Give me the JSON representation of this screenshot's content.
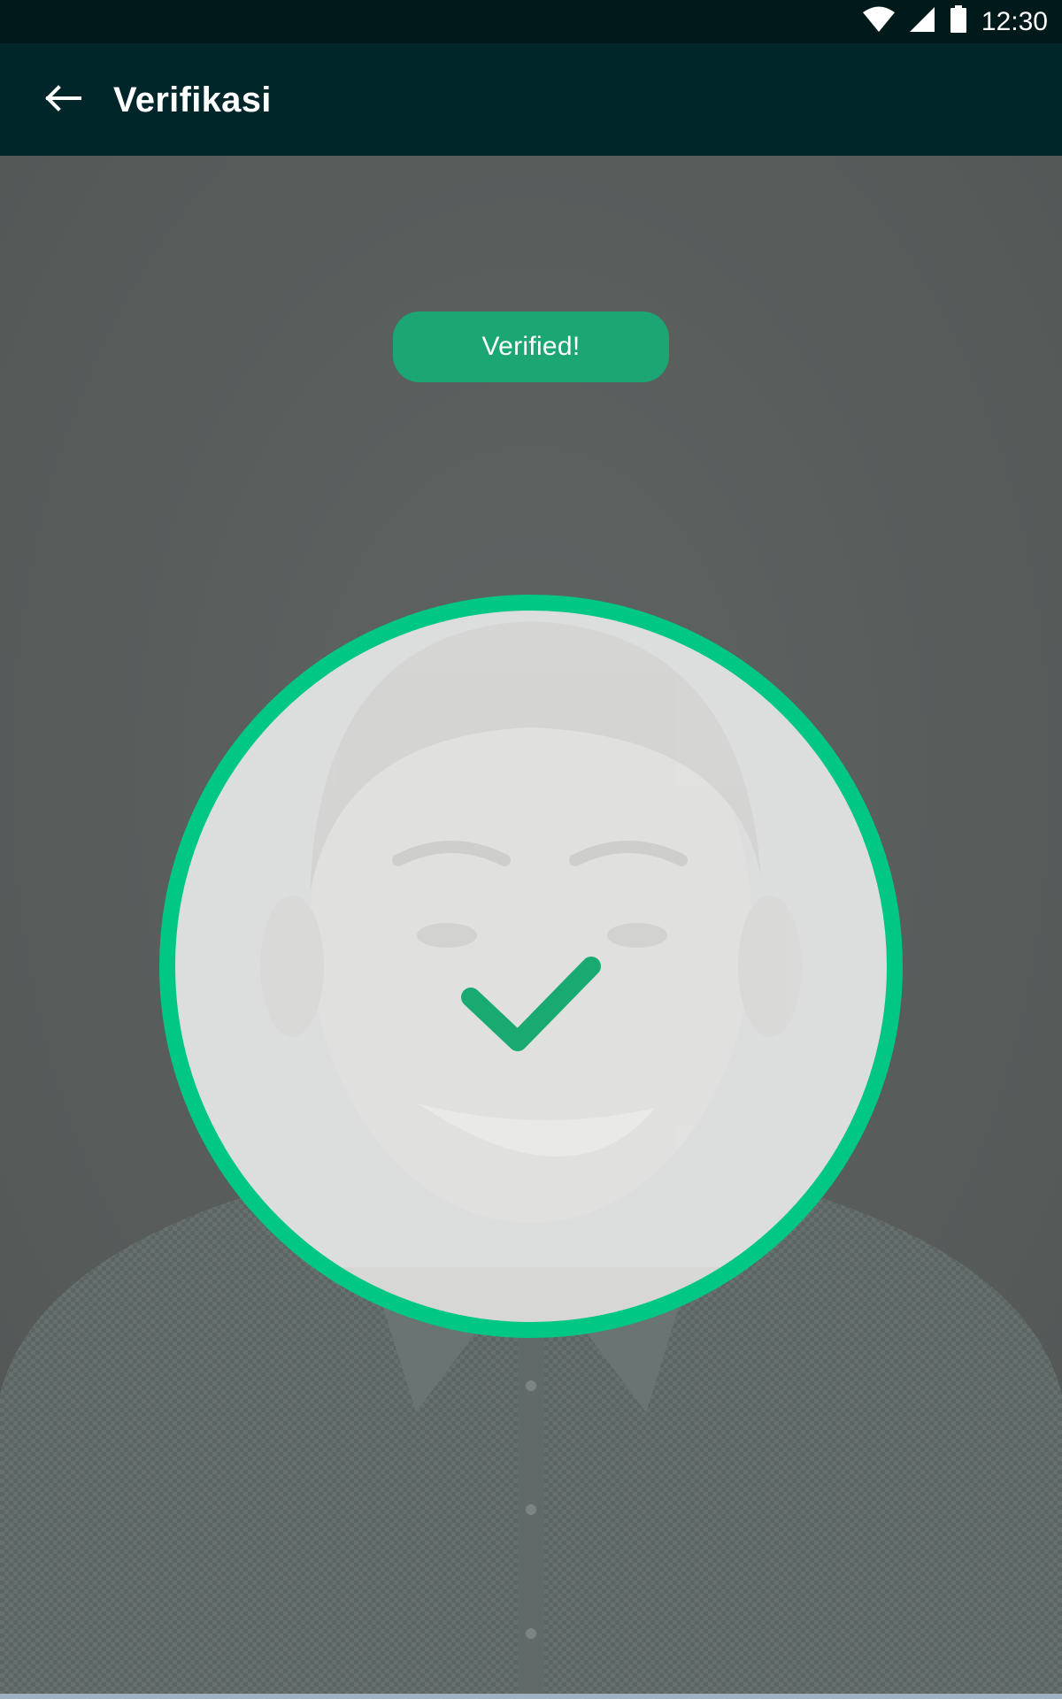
{
  "status_bar": {
    "time": "12:30",
    "icons": [
      "wifi-icon",
      "cellular-signal-icon",
      "battery-icon"
    ]
  },
  "app_bar": {
    "title": "Verifikasi",
    "back_icon": "arrow-left-icon"
  },
  "verification": {
    "badge_label": "Verified!",
    "status_icon": "checkmark-icon"
  },
  "colors": {
    "status_bar_bg": "#00191b",
    "app_bar_bg": "#00262a",
    "badge_bg": "#1ba673",
    "frame_ring": "#00c783",
    "checkmark": "#19aa72",
    "overlay": "#5a5d5c"
  }
}
